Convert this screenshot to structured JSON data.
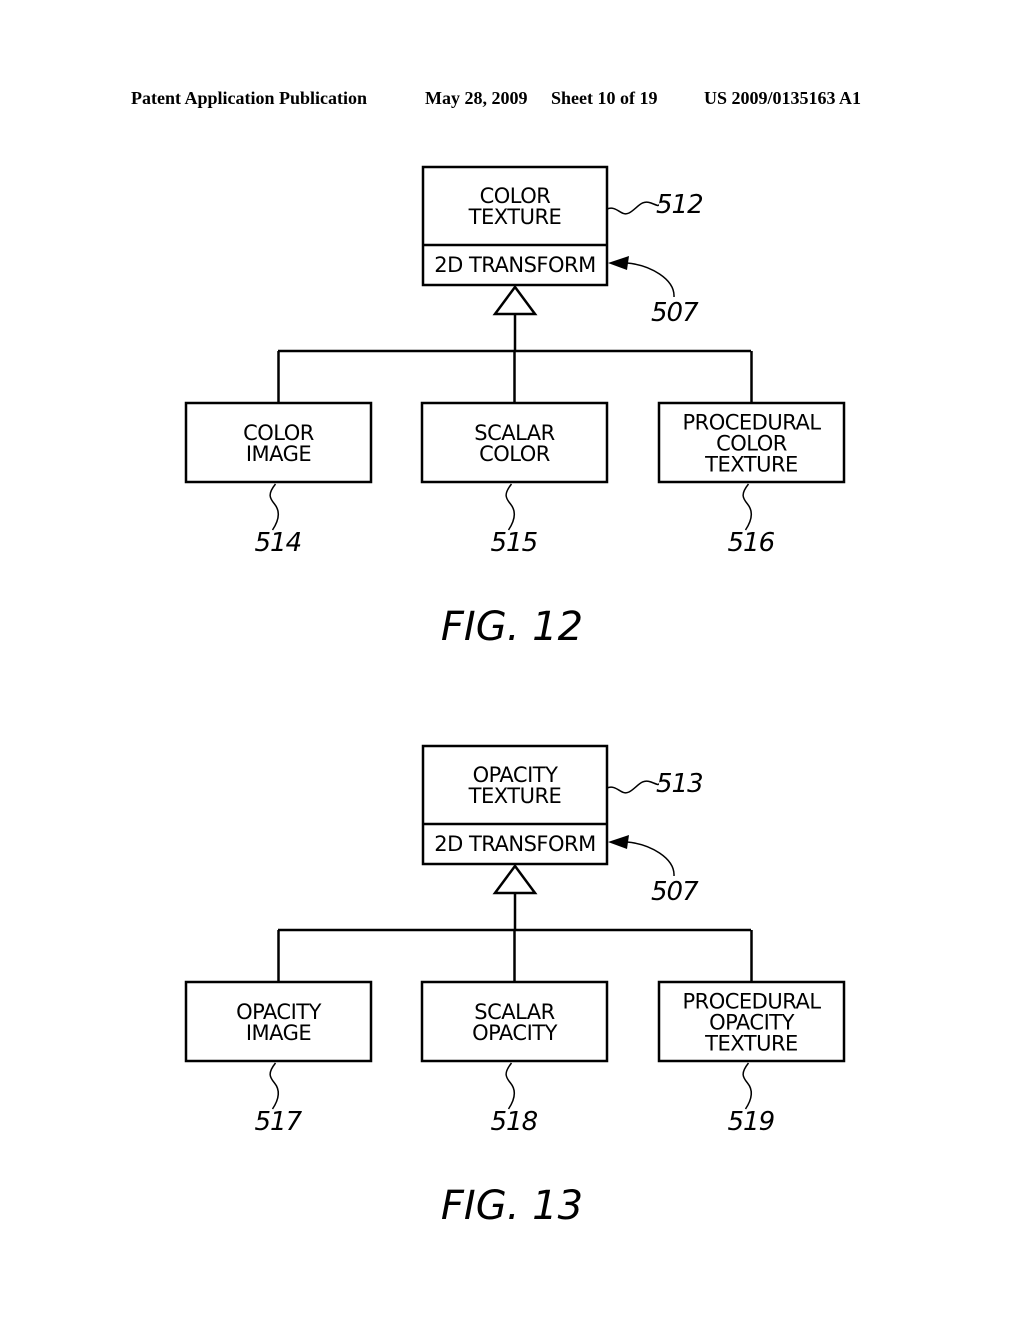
{
  "header": {
    "publication": "Patent Application Publication",
    "date": "May 28, 2009",
    "sheet": "Sheet 10 of 19",
    "number": "US 2009/0135163 A1"
  },
  "figures": [
    {
      "caption": "FIG. 12",
      "parent": {
        "lines": [
          "COLOR",
          "TEXTURE"
        ],
        "method": "2D TRANSFORM",
        "ref": "512",
        "method_ref": "507"
      },
      "children": [
        {
          "lines": [
            "COLOR",
            "IMAGE"
          ],
          "ref": "514"
        },
        {
          "lines": [
            "SCALAR",
            "COLOR"
          ],
          "ref": "515"
        },
        {
          "lines": [
            "PROCEDURAL",
            "COLOR",
            "TEXTURE"
          ],
          "ref": "516"
        }
      ]
    },
    {
      "caption": "FIG. 13",
      "parent": {
        "lines": [
          "OPACITY",
          "TEXTURE"
        ],
        "method": "2D TRANSFORM",
        "ref": "513",
        "method_ref": "507"
      },
      "children": [
        {
          "lines": [
            "OPACITY",
            "IMAGE"
          ],
          "ref": "517"
        },
        {
          "lines": [
            "SCALAR",
            "OPACITY"
          ],
          "ref": "518"
        },
        {
          "lines": [
            "PROCEDURAL",
            "OPACITY",
            "TEXTURE"
          ],
          "ref": "519"
        }
      ]
    }
  ]
}
